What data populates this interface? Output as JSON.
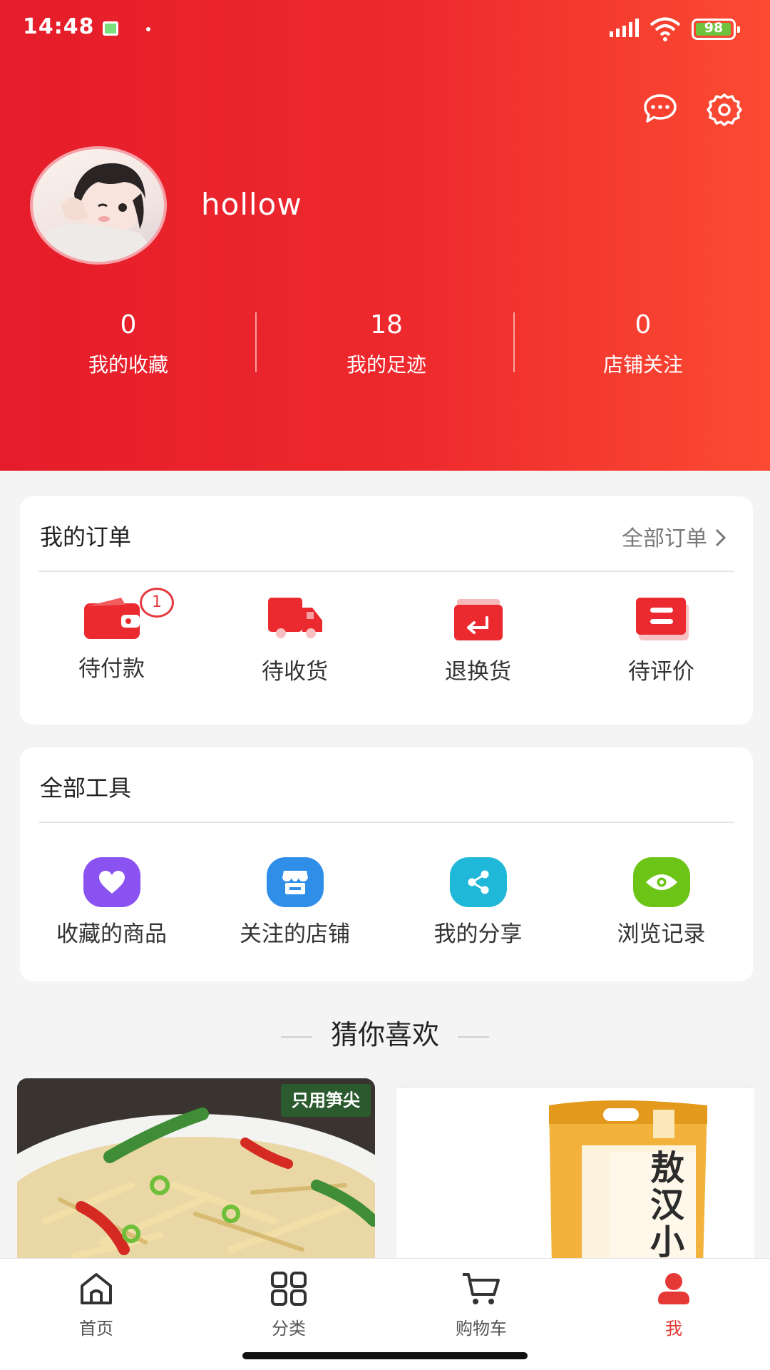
{
  "status_bar": {
    "time": "14:48",
    "battery": "98",
    "battery_level": 0.98
  },
  "profile": {
    "username": "hollow"
  },
  "stats": [
    {
      "value": "0",
      "label": "我的收藏"
    },
    {
      "value": "18",
      "label": "我的足迹"
    },
    {
      "value": "0",
      "label": "店铺关注"
    }
  ],
  "orders": {
    "title": "我的订单",
    "view_all": "全部订单",
    "items": [
      {
        "label": "待付款",
        "icon": "wallet-icon",
        "badge": "1"
      },
      {
        "label": "待收货",
        "icon": "truck-icon"
      },
      {
        "label": "退换货",
        "icon": "return-icon"
      },
      {
        "label": "待评价",
        "icon": "review-icon"
      }
    ]
  },
  "tools": {
    "title": "全部工具",
    "items": [
      {
        "label": "收藏的商品",
        "icon": "heart-icon",
        "color": "#8a52f0"
      },
      {
        "label": "关注的店铺",
        "icon": "store-icon",
        "color": "#2f8fe8"
      },
      {
        "label": "我的分享",
        "icon": "share-icon",
        "color": "#1fb8d9"
      },
      {
        "label": "浏览记录",
        "icon": "eye-icon",
        "color": "#6cc417"
      }
    ]
  },
  "recommend": {
    "title": "猜你喜欢",
    "products": [
      {
        "tag": "只用笋尖"
      },
      {
        "brand": "敖汉小米"
      }
    ]
  },
  "nav": {
    "items": [
      {
        "label": "首页",
        "icon": "home-icon"
      },
      {
        "label": "分类",
        "icon": "category-icon"
      },
      {
        "label": "购物车",
        "icon": "cart-icon"
      },
      {
        "label": "我",
        "icon": "profile-icon",
        "active": true
      }
    ]
  },
  "colors": {
    "brand": "#e8202b",
    "active": "#e53935"
  }
}
